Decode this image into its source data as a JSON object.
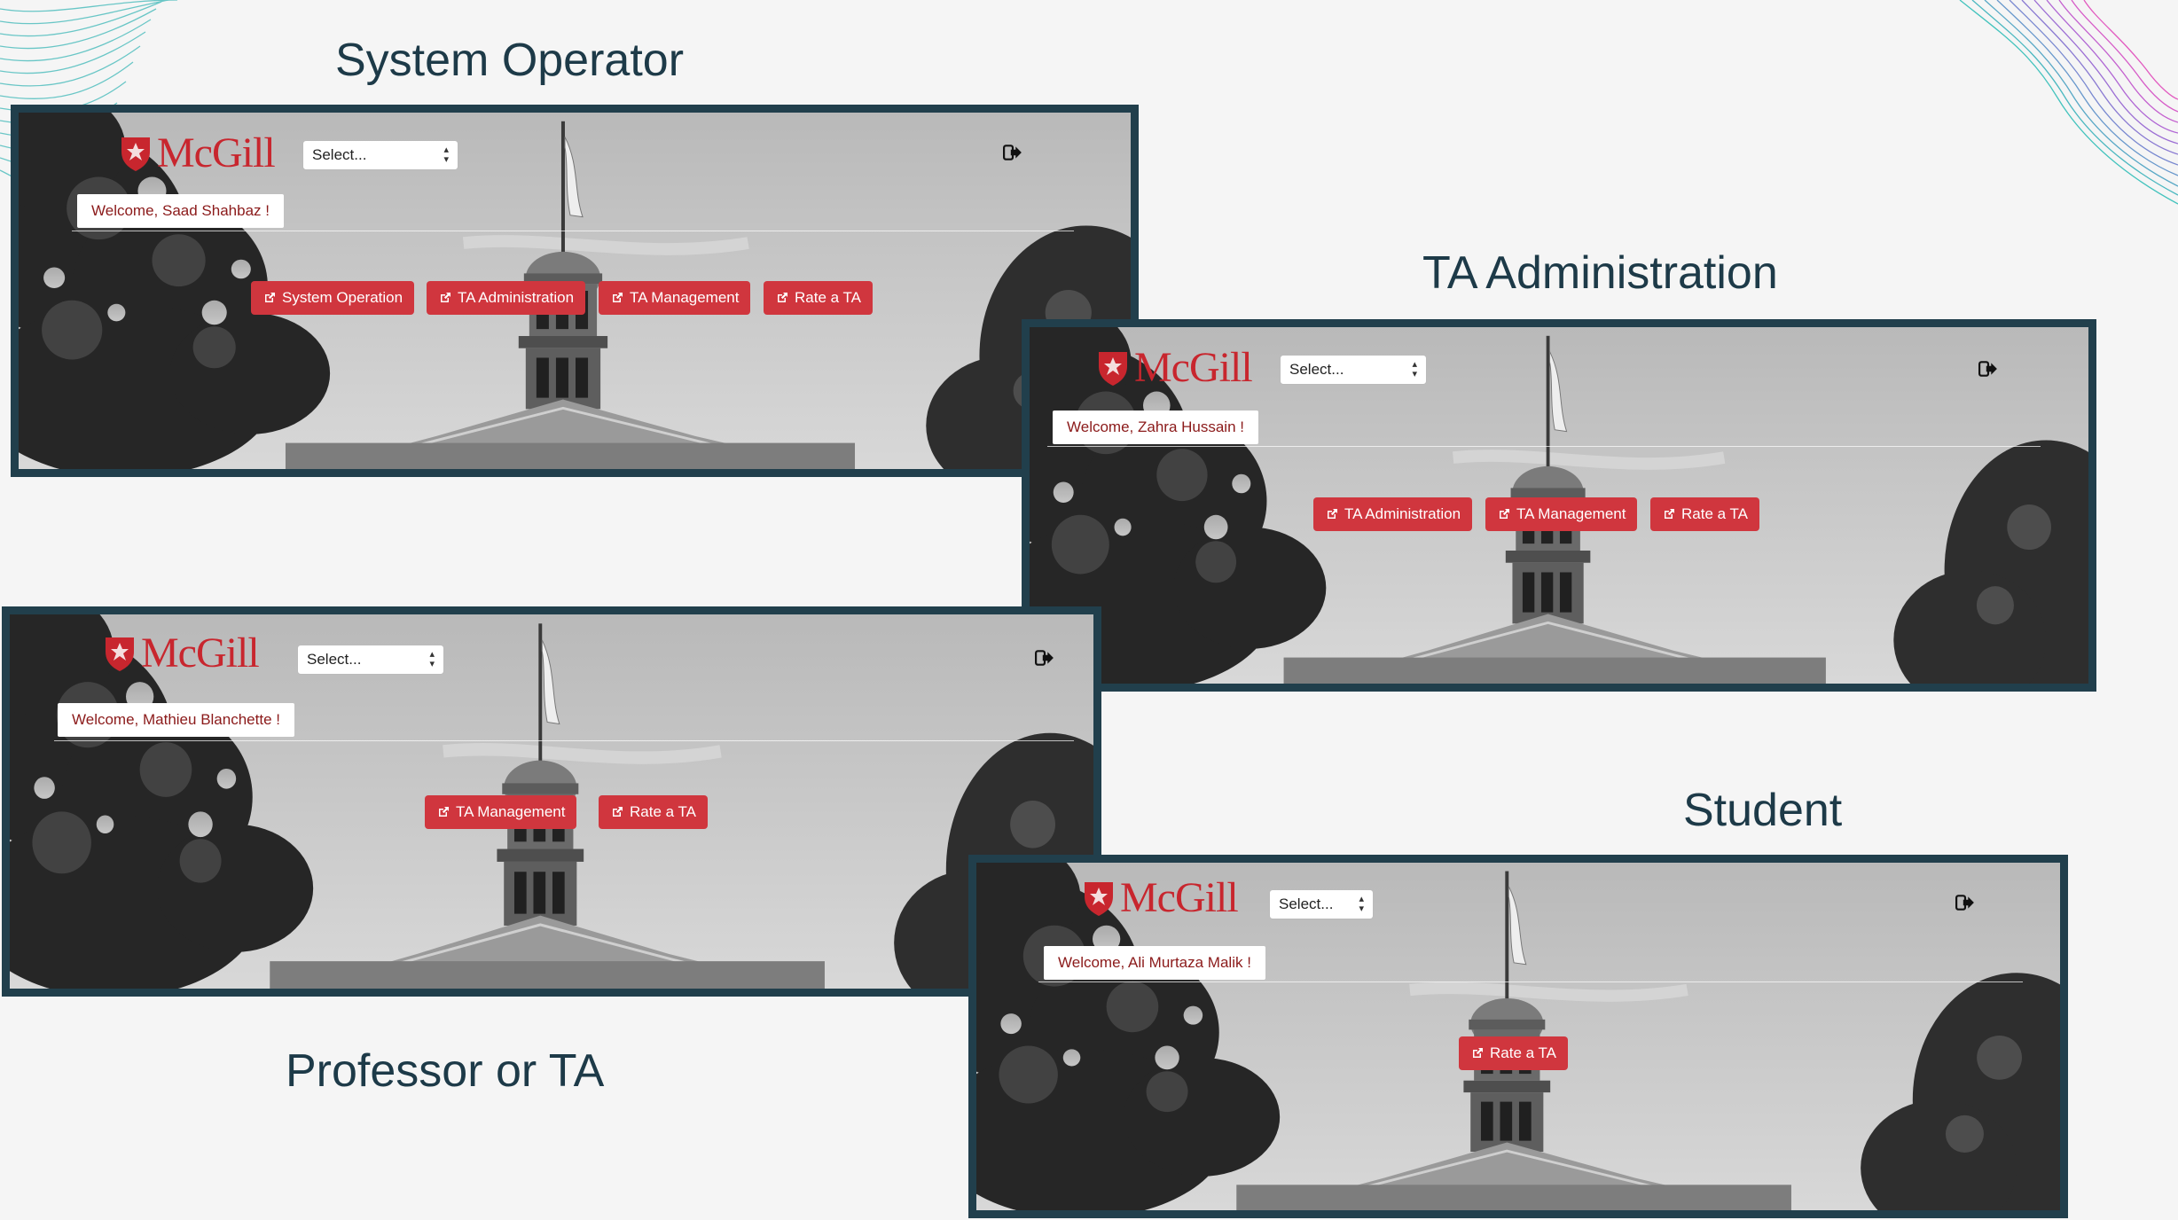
{
  "slide": {
    "accent_color": "#d0363e",
    "title_color": "#1d3a48",
    "frame_color": "#213f4c"
  },
  "sections": {
    "system_operator": {
      "title": "System Operator",
      "brand": "McGill",
      "select_value": "Select...",
      "welcome": "Welcome, Saad Shahbaz !",
      "buttons": [
        "System Operation",
        "TA Administration",
        "TA Management",
        "Rate a TA"
      ]
    },
    "ta_administration": {
      "title": "TA Administration",
      "brand": "McGill",
      "select_value": "Select...",
      "welcome": "Welcome, Zahra Hussain !",
      "buttons": [
        "TA Administration",
        "TA Management",
        "Rate a TA"
      ]
    },
    "professor_or_ta": {
      "title": "Professor or TA",
      "brand": "McGill",
      "select_value": "Select...",
      "welcome": "Welcome, Mathieu Blanchette !",
      "buttons": [
        "TA Management",
        "Rate a TA"
      ]
    },
    "student": {
      "title": "Student",
      "brand": "McGill",
      "select_value": "Select...",
      "welcome": "Welcome, Ali Murtaza Malik !",
      "buttons": [
        "Rate a TA"
      ]
    }
  },
  "icons": {
    "logo": "mcgill-shield-icon",
    "logout": "logout-icon",
    "button": "external-link-icon",
    "select": "chevron-up-down-icon"
  }
}
